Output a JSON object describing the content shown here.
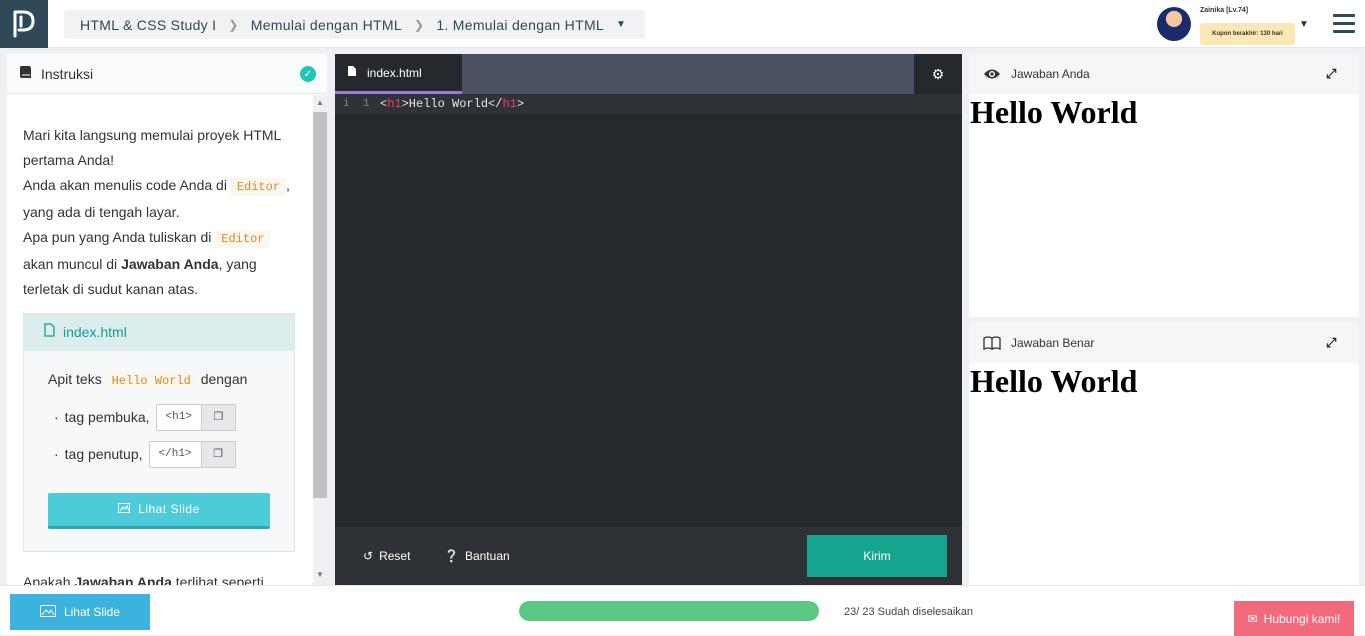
{
  "header": {
    "breadcrumb": [
      "HTML & CSS Study I",
      "Memulai dengan HTML",
      "1. Memulai dengan HTML"
    ],
    "user_name": "Zainika [Lv.74]",
    "coupon": "Kupon berakhir: 130 hari"
  },
  "instructions": {
    "title": "Instruksi",
    "p1_a": "Mari kita langsung memulai proyek HTML pertama Anda!",
    "p2_a": "Anda akan menulis code Anda di ",
    "editor_code": "Editor",
    "p2_b": ", yang ada di tengah layar.",
    "p3_a": "Apa pun yang Anda tuliskan di ",
    "p3_b": " akan muncul di ",
    "jawaban_anda": "Jawaban Anda",
    "p3_c": ", yang terletak di sudut kanan atas.",
    "file_box_title": "index.html",
    "apit_a": "Apit teks ",
    "hello_world_code": "Hello World",
    "apit_b": " dengan",
    "tag_open_label": "tag pembuka,",
    "tag_open_value": "<h1>",
    "tag_close_label": "tag penutup,",
    "tag_close_value": "</h1>",
    "slide_button": "Lihat Slide",
    "bottom_text_a": "Apakah ",
    "bottom_text_b": "Jawaban Anda",
    "bottom_text_c": " terlihat seperti"
  },
  "editor": {
    "tab_name": "index.html",
    "line_number": "1",
    "code_open_bracket": "<",
    "code_tag": "h1",
    "code_text": ">Hello World</",
    "code_tag_close": "h1",
    "code_end": ">",
    "reset_label": "Reset",
    "help_label": "Bantuan",
    "submit_label": "Kirim"
  },
  "your_answer": {
    "title": "Jawaban Anda",
    "content": "Hello World"
  },
  "correct_answer": {
    "title": "Jawaban Benar",
    "content": "Hello World"
  },
  "footer": {
    "slide_button": "Lihat Slide",
    "progress_fraction": 1.0,
    "progress_text": "23/ 23 Sudah diselesaikan",
    "contact_button": "Hubungi kami!"
  },
  "colors": {
    "brand_dark": "#2f4858",
    "accent_teal": "#15a58f",
    "progress": "#5cc785",
    "contact": "#f26b7c",
    "slide": "#4ecbd9"
  }
}
